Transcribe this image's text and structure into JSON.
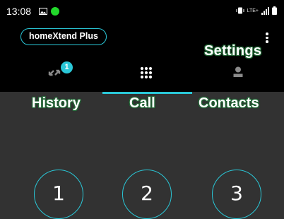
{
  "status_bar": {
    "time": "13:08",
    "network_label": "LTE+",
    "icons": [
      "gallery-icon",
      "notification-dot-icon",
      "vibrate-icon",
      "signal-icon",
      "battery-icon"
    ],
    "dot_color": "#22d82b"
  },
  "app_bar": {
    "brand": "homeXtend Plus",
    "settings_annotation": "Settings",
    "accent_color": "#2ac8d8"
  },
  "tabs": [
    {
      "id": "history",
      "icon": "missed-calls-icon",
      "annotation": "History",
      "badge": "1",
      "selected": false
    },
    {
      "id": "call",
      "icon": "dialpad-icon",
      "annotation": "Call",
      "selected": true
    },
    {
      "id": "contacts",
      "icon": "person-icon",
      "annotation": "Contacts",
      "selected": false
    }
  ],
  "keypad": {
    "keys": [
      "1",
      "2",
      "3"
    ]
  }
}
